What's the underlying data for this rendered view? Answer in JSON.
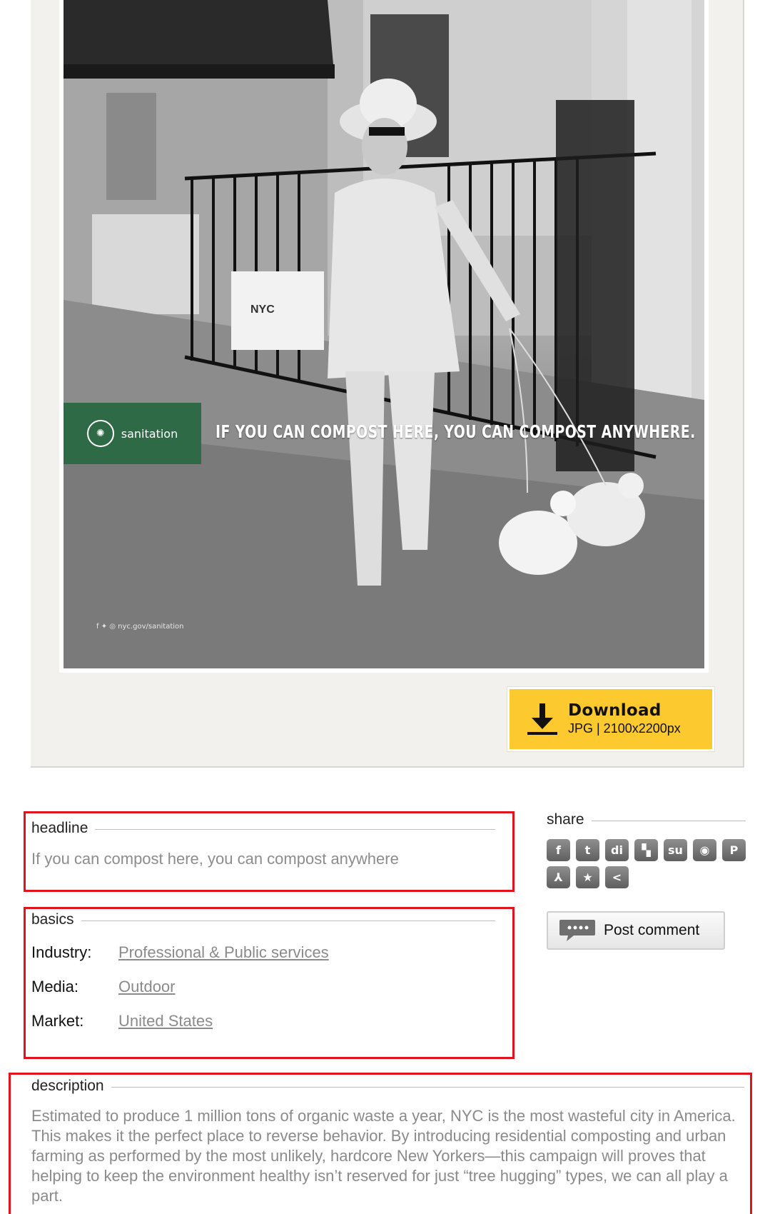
{
  "ad": {
    "badge_label": "sanitation",
    "tagline": "IF YOU CAN COMPOST HERE, YOU CAN COMPOST ANYWHERE.",
    "bag_label": "NYC",
    "footer_social": "nyc.gov/sanitation"
  },
  "download": {
    "title": "Download",
    "meta": "JPG | 2100x2200px"
  },
  "headline": {
    "legend": "headline",
    "text": "If you can compost here, you can compost anywhere"
  },
  "basics": {
    "legend": "basics",
    "rows": [
      {
        "label": "Industry:",
        "value": "Professional & Public services"
      },
      {
        "label": "Media:",
        "value": "Outdoor"
      },
      {
        "label": "Market:",
        "value": "United States"
      }
    ]
  },
  "description": {
    "legend": "description",
    "text": "Estimated to produce 1 million tons of organic waste a year, NYC is the most wasteful city in America. This makes it the perfect place to reverse behavior. By introducing residential composting and urban farming as performed by the most unlikely, hardcore New Yorkers—this campaign will proves that helping to keep the environment healthy isn’t reserved for just “tree hugging” types, we can all play a part."
  },
  "share": {
    "legend": "share",
    "icons": [
      {
        "name": "facebook-icon",
        "glyph": "f"
      },
      {
        "name": "twitter-icon",
        "glyph": "t"
      },
      {
        "name": "digg-icon",
        "glyph": "di"
      },
      {
        "name": "delicious-icon",
        "glyph": "▚"
      },
      {
        "name": "stumbleupon-icon",
        "glyph": "su"
      },
      {
        "name": "weibo-icon",
        "glyph": "◉"
      },
      {
        "name": "pinterest-icon",
        "glyph": "P"
      },
      {
        "name": "pdf-icon",
        "glyph": "⅄"
      },
      {
        "name": "favorite-icon",
        "glyph": "★"
      },
      {
        "name": "share-icon",
        "glyph": "<"
      }
    ],
    "post_comment_label": "Post comment"
  }
}
